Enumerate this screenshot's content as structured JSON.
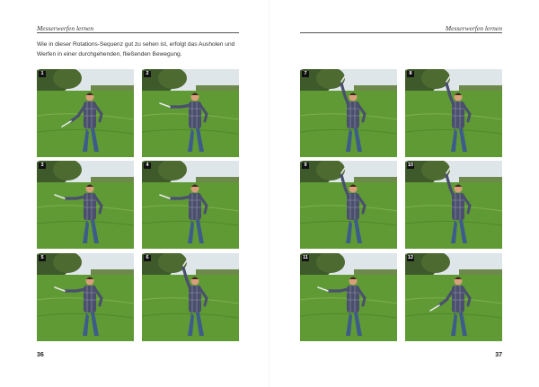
{
  "left_page": {
    "running_head": "Messerwerfen lernen",
    "intro": "Wie in dieser Rotations-Sequenz gut zu sehen ist, erfolgt das Ausholen und Werfen in einer durchgehenden, fließenden Bewegung.",
    "folio": "36",
    "photos": [
      {
        "number": "1",
        "arm": "low"
      },
      {
        "number": "2",
        "arm": "side"
      },
      {
        "number": "3",
        "arm": "side"
      },
      {
        "number": "4",
        "arm": "side"
      },
      {
        "number": "5",
        "arm": "side"
      },
      {
        "number": "6",
        "arm": "up"
      }
    ]
  },
  "right_page": {
    "running_head": "Messerwerfen lernen",
    "folio": "37",
    "photos": [
      {
        "number": "7",
        "arm": "up"
      },
      {
        "number": "8",
        "arm": "up"
      },
      {
        "number": "9",
        "arm": "up"
      },
      {
        "number": "10",
        "arm": "up"
      },
      {
        "number": "11",
        "arm": "side"
      },
      {
        "number": "12",
        "arm": "low"
      }
    ]
  },
  "colors": {
    "sky": "#dfe6ea",
    "tree": "#3f5a2a",
    "grass": "#5f9a35",
    "shirt": "#4a4f6e",
    "jeans": "#3d5c8c"
  }
}
